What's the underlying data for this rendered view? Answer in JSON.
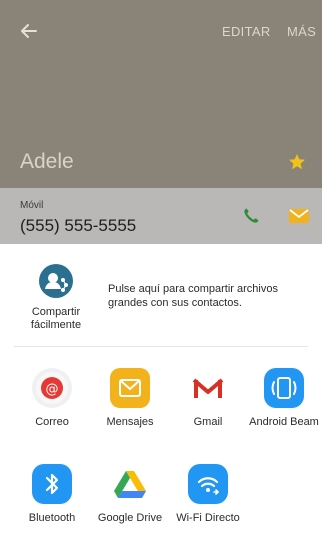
{
  "header": {
    "edit_label": "EDITAR",
    "more_label": "MÁS",
    "contact_name": "Adele",
    "bg_color": "#8a8377"
  },
  "phone": {
    "label": "Móvil",
    "number": "(555) 555-5555"
  },
  "share": {
    "quick_share_label": "Compartir fácilmente",
    "quick_share_desc": "Pulse aquí para compartir archivos grandes con sus contactos.",
    "apps": [
      {
        "label": "Correo"
      },
      {
        "label": "Mensajes"
      },
      {
        "label": "Gmail"
      },
      {
        "label": "Android Beam"
      },
      {
        "label": "Bluetooth"
      },
      {
        "label": "Google Drive"
      },
      {
        "label": "Wi-Fi Directo"
      }
    ]
  }
}
